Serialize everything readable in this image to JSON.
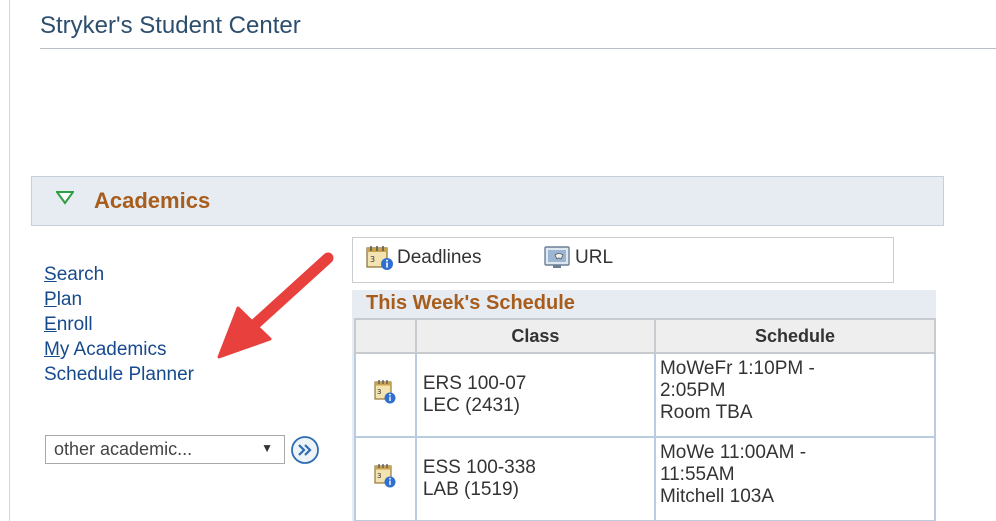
{
  "page": {
    "title": "Stryker's Student Center"
  },
  "academics": {
    "title": "Academics",
    "nav_links": [
      {
        "underline": "S",
        "rest": "earch"
      },
      {
        "underline": "P",
        "rest": "lan"
      },
      {
        "underline": "E",
        "rest": "nroll"
      },
      {
        "underline": "M",
        "rest": "y Academics"
      },
      {
        "underline": "",
        "rest": "Schedule Planner"
      }
    ],
    "other_select": {
      "value": "other academic..."
    },
    "links": {
      "deadlines": "Deadlines",
      "url": "URL"
    },
    "schedule": {
      "title": "This Week's Schedule",
      "columns": [
        "",
        "Class",
        "Schedule"
      ],
      "rows": [
        {
          "class_line1": "ERS 100-07",
          "class_line2": "LEC (2431)",
          "sched_line1": "MoWeFr 1:10PM -",
          "sched_line2": "2:05PM",
          "sched_line3": "Room  TBA"
        },
        {
          "class_line1": "ESS 100-338",
          "class_line2": "LAB (1519)",
          "sched_line1": "MoWe 11:00AM -",
          "sched_line2": "11:55AM",
          "sched_line3": "Mitchell 103A"
        }
      ]
    }
  },
  "icons": {
    "toggle": "triangle-down-icon",
    "deadlines": "calendar-info-icon",
    "url": "url-link-icon",
    "go": "double-chevron-right-icon",
    "row": "class-detail-icon",
    "annotation": "red-arrow-icon"
  },
  "colors": {
    "link": "#174a8c",
    "section_title": "#a85d1c",
    "panel": "#e6ecf1",
    "annotation_arrow": "#e8403d"
  }
}
